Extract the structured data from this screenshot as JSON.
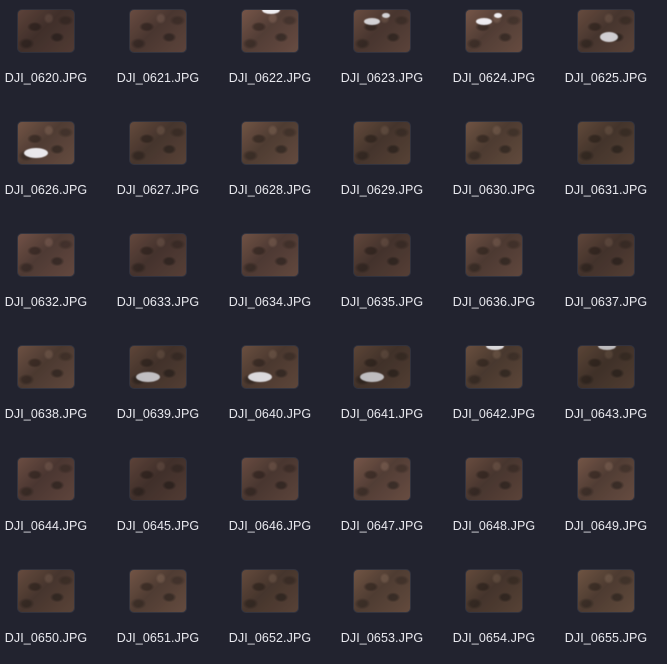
{
  "files": [
    {
      "name": "DJI_0620.JPG",
      "snow": 0
    },
    {
      "name": "DJI_0621.JPG",
      "snow": 0
    },
    {
      "name": "DJI_0622.JPG",
      "snow": 1
    },
    {
      "name": "DJI_0623.JPG",
      "snow": 2
    },
    {
      "name": "DJI_0624.JPG",
      "snow": 2
    },
    {
      "name": "DJI_0625.JPG",
      "snow": 3
    },
    {
      "name": "DJI_0626.JPG",
      "snow": 4
    },
    {
      "name": "DJI_0627.JPG",
      "snow": 0
    },
    {
      "name": "DJI_0628.JPG",
      "snow": 0
    },
    {
      "name": "DJI_0629.JPG",
      "snow": 0
    },
    {
      "name": "DJI_0630.JPG",
      "snow": 0
    },
    {
      "name": "DJI_0631.JPG",
      "snow": 0
    },
    {
      "name": "DJI_0632.JPG",
      "snow": 0
    },
    {
      "name": "DJI_0633.JPG",
      "snow": 0
    },
    {
      "name": "DJI_0634.JPG",
      "snow": 0
    },
    {
      "name": "DJI_0635.JPG",
      "snow": 0
    },
    {
      "name": "DJI_0636.JPG",
      "snow": 0
    },
    {
      "name": "DJI_0637.JPG",
      "snow": 0
    },
    {
      "name": "DJI_0638.JPG",
      "snow": 0
    },
    {
      "name": "DJI_0639.JPG",
      "snow": 4
    },
    {
      "name": "DJI_0640.JPG",
      "snow": 4
    },
    {
      "name": "DJI_0641.JPG",
      "snow": 4
    },
    {
      "name": "DJI_0642.JPG",
      "snow": 1
    },
    {
      "name": "DJI_0643.JPG",
      "snow": 1
    },
    {
      "name": "DJI_0644.JPG",
      "snow": 0
    },
    {
      "name": "DJI_0645.JPG",
      "snow": 0
    },
    {
      "name": "DJI_0646.JPG",
      "snow": 0
    },
    {
      "name": "DJI_0647.JPG",
      "snow": 0
    },
    {
      "name": "DJI_0648.JPG",
      "snow": 0
    },
    {
      "name": "DJI_0649.JPG",
      "snow": 0
    },
    {
      "name": "DJI_0650.JPG",
      "snow": 0
    },
    {
      "name": "DJI_0651.JPG",
      "snow": 0
    },
    {
      "name": "DJI_0652.JPG",
      "snow": 0
    },
    {
      "name": "DJI_0653.JPG",
      "snow": 0
    },
    {
      "name": "DJI_0654.JPG",
      "snow": 0
    },
    {
      "name": "DJI_0655.JPG",
      "snow": 0
    }
  ]
}
